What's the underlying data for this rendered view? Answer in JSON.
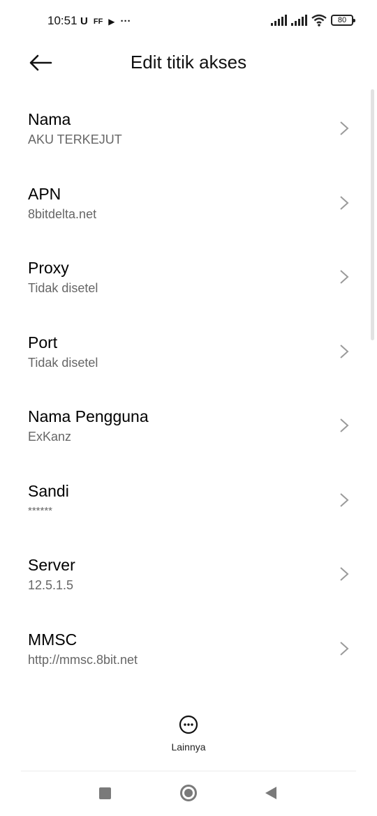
{
  "status_bar": {
    "time": "10:51",
    "left_icons": [
      "U",
      "FF",
      "▶",
      "···"
    ],
    "battery": "80"
  },
  "header": {
    "title": "Edit titik akses"
  },
  "items": [
    {
      "label": "Nama",
      "value": "AKU TERKEJUT"
    },
    {
      "label": "APN",
      "value": "8bitdelta.net"
    },
    {
      "label": "Proxy",
      "value": "Tidak disetel"
    },
    {
      "label": "Port",
      "value": "Tidak disetel"
    },
    {
      "label": "Nama Pengguna",
      "value": "ExKanz"
    },
    {
      "label": "Sandi",
      "value": "******"
    },
    {
      "label": "Server",
      "value": "12.5.1.5"
    },
    {
      "label": "MMSC",
      "value": "http://mmsc.8bit.net"
    }
  ],
  "more": {
    "label": "Lainnya"
  }
}
